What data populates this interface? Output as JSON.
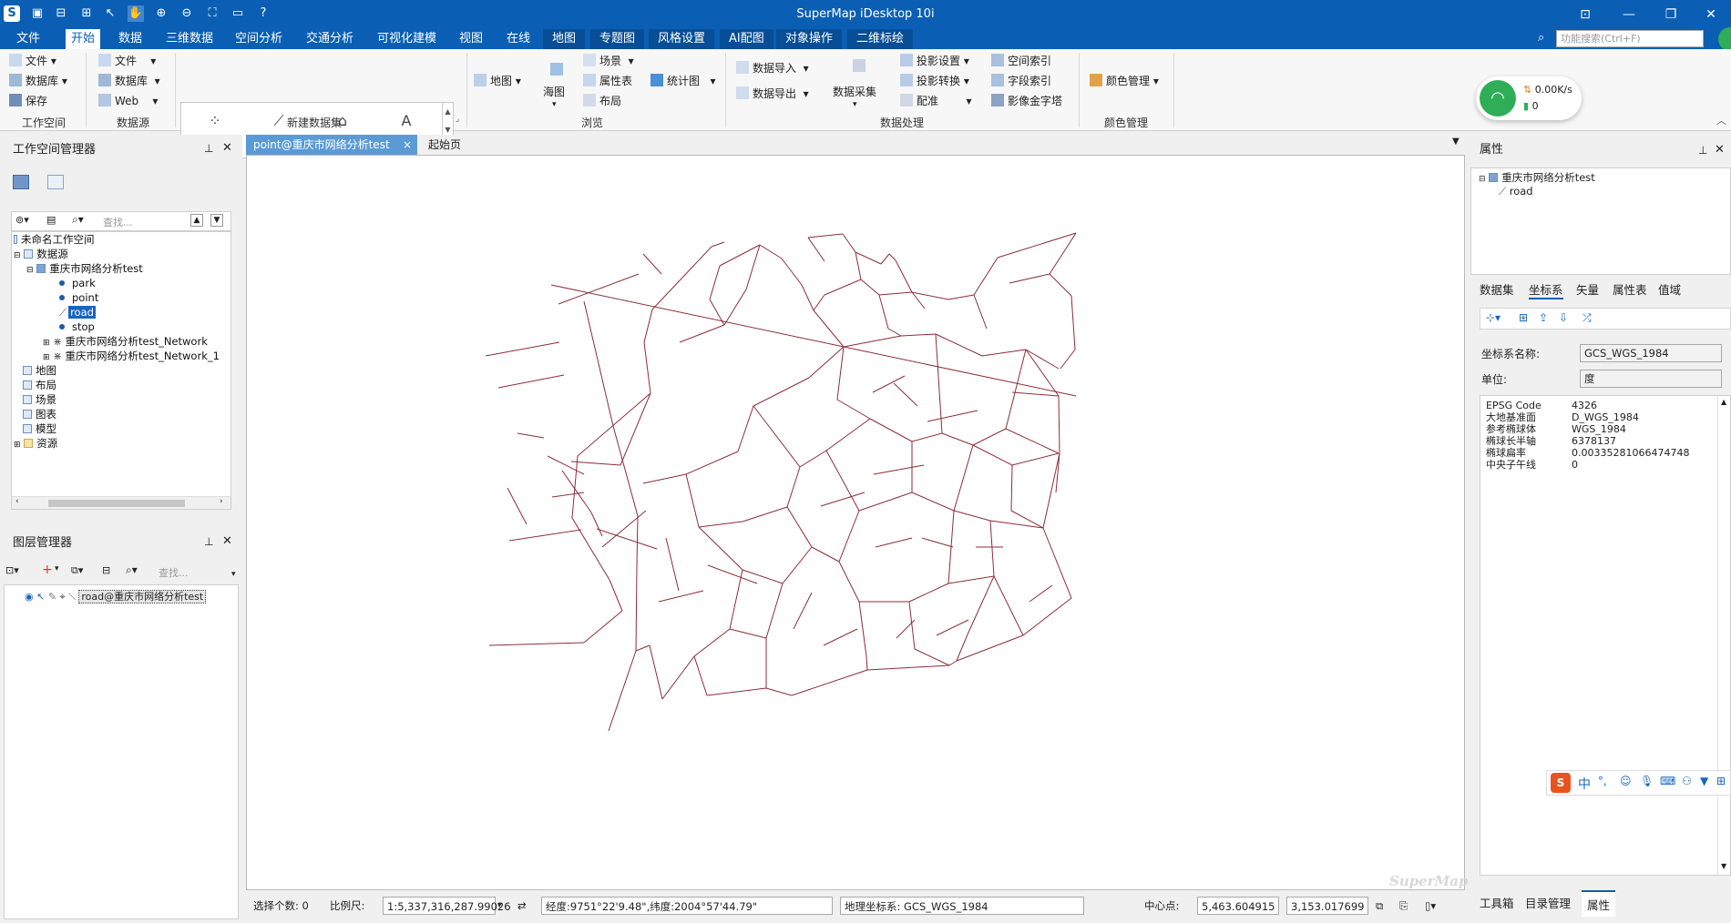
{
  "window": {
    "title": "SuperMap iDesktop 10i"
  },
  "menus": [
    "文件",
    "开始",
    "数据",
    "三维数据",
    "空间分析",
    "交通分析",
    "可视化建模",
    "视图",
    "在线",
    "地图",
    "专题图",
    "风格设置",
    "AI配图",
    "对象操作",
    "二维标绘"
  ],
  "search": {
    "placeholder": "功能搜索(Ctrl+F)"
  },
  "ribbon": {
    "workspace": {
      "items": [
        "文件",
        "数据库",
        "保存"
      ],
      "group": "工作空间"
    },
    "datasource": {
      "items": [
        "文件",
        "数据库",
        "Web"
      ],
      "group": "数据源"
    },
    "new_dataset": {
      "items": [
        "点",
        "线",
        "面",
        "文本"
      ],
      "group": "新建数据集"
    },
    "browse": {
      "map": "地图",
      "sea": "海图",
      "scene": "场景",
      "attr": "属性表",
      "layout": "布局",
      "stat": "统计图",
      "group": "浏览"
    },
    "data_proc": {
      "import": "数据导入",
      "export": "数据导出",
      "collect": "数据采集",
      "proj_set": "投影设置",
      "proj_conv": "投影转换",
      "register": "配准",
      "sp_index": "空间索引",
      "field_index": "字段索引",
      "pyramid": "影像金字塔",
      "group": "数据处理"
    },
    "color": {
      "item": "颜色管理",
      "group": "颜色管理"
    }
  },
  "network": {
    "speed": "0.00K/s",
    "count": "0"
  },
  "workspace_panel": {
    "title": "工作空间管理器",
    "search": "查找...",
    "tree": {
      "root": "未命名工作空间",
      "datasources": "数据源",
      "ds": "重庆市网络分析test",
      "datasets": [
        "park",
        "point",
        "road",
        "stop"
      ],
      "net1": "重庆市网络分析test_Network",
      "net2": "重庆市网络分析test_Network_1",
      "others": [
        "地图",
        "布局",
        "场景",
        "图表",
        "模型",
        "资源"
      ]
    }
  },
  "layer_panel": {
    "title": "图层管理器",
    "search": "查找...",
    "layer": "road@重庆市网络分析test"
  },
  "doc_tabs": [
    "point@重庆市网络分析test",
    "起始页"
  ],
  "watermark": "SuperMap",
  "status": {
    "sel_label": "选择个数:",
    "sel_value": "0",
    "scale_label": "比例尺:",
    "scale_value": "1:5,337,316,287.99026",
    "coord": "经度:9751°22'9.48\",纬度:2004°57'44.79\"",
    "crs": "地理坐标系: GCS_WGS_1984",
    "center_label": "中心点:",
    "cx": "5,463.604915",
    "cy": "3,153.017699"
  },
  "props": {
    "title": "属性",
    "tree": {
      "ds": "重庆市网络分析test",
      "dataset": "road"
    },
    "tabs": [
      "数据集",
      "坐标系",
      "矢量",
      "属性表",
      "值域"
    ],
    "crs_name_label": "坐标系名称:",
    "crs_name": "GCS_WGS_1984",
    "unit_label": "单位:",
    "unit": "度",
    "details": [
      [
        "EPSG Code",
        "4326"
      ],
      [
        "大地基准面",
        "D_WGS_1984"
      ],
      [
        "参考椭球体",
        "WGS_1984"
      ],
      [
        "椭球长半轴",
        "6378137"
      ],
      [
        "椭球扁率",
        "0.00335281066474748"
      ],
      [
        "中央子午线",
        "0"
      ]
    ],
    "bottom_tabs": [
      "工具箱",
      "目录管理",
      "属性"
    ]
  },
  "ime": {
    "lang": "中"
  },
  "colors": {
    "accent": "#0a5fb4",
    "road": "#8b2e3a"
  }
}
